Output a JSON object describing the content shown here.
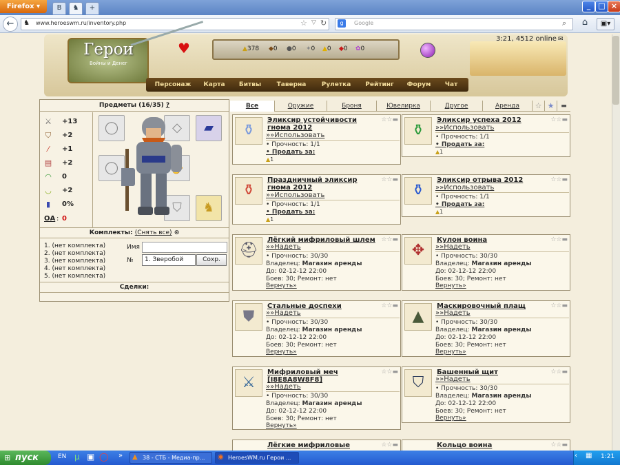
{
  "browser": {
    "firefox_label": "Firefox",
    "url": "www.heroeswm.ru/inventory.php",
    "search_placeholder": "Google",
    "tab1_icon": "В"
  },
  "header": {
    "logo_title": "Герои",
    "logo_sub": "Войны и Денег",
    "resources": [
      "378",
      "0",
      "0",
      "0",
      "0",
      "0",
      "0"
    ],
    "online": "3:21, 4512 online",
    "menu": [
      "Персонаж",
      "Карта",
      "Битвы",
      "Таверна",
      "Рулетка",
      "Рейтинг",
      "Форум",
      "Чат"
    ]
  },
  "left": {
    "items_title": "Предметы (16/35)",
    "help": "?",
    "stats": [
      "+13",
      "+2",
      "+1",
      "+2",
      "0",
      "+2",
      "0%"
    ],
    "oa_label": "ОА",
    "oa_value": "0",
    "kits_title": "Комплекты:",
    "kits_remove": "(Снять все)",
    "kits": [
      "1. (нет комплекта)",
      "2. (нет комплекта)",
      "3. (нет комплекта)",
      "4. (нет комплекта)",
      "5. (нет комплекта)"
    ],
    "name_label": "Имя",
    "no_label": "№",
    "kit_select": "1. Зверобой",
    "save": "Сохр.",
    "deals": "Сделки:"
  },
  "tabs": [
    "Все",
    "Оружие",
    "Броня",
    "Ювелирка",
    "Другое",
    "Аренда"
  ],
  "labels": {
    "use": "»»Использовать",
    "wear": "»»Надеть",
    "sell": "Продать за:",
    "return": "Вернуть»",
    "owner": "Владелец:",
    "shop": "Магазин аренды",
    "until": "До: 02-12-12 22:00",
    "fights": "Боев: 30;   Ремонт: нет"
  },
  "items": [
    {
      "name": "Эликсир устойчивости гнома 2012",
      "durability": "Прочность: 1/1",
      "count": "1"
    },
    {
      "name": "Эликсир успеха 2012",
      "durability": "Прочность: 1/1",
      "count": "1"
    },
    {
      "name": "Праздничный эликсир гнома 2012",
      "durability": "Прочность: 1/1",
      "count": "1"
    },
    {
      "name": "Эликсир отрыва 2012",
      "durability": "Прочность: 1/1",
      "count": "1"
    },
    {
      "name": "Лёгкий мифриловый шлем",
      "durability": "Прочность: 30/30"
    },
    {
      "name": "Кулон воина",
      "durability": "Прочность: 30/30"
    },
    {
      "name": "Стальные доспехи",
      "durability": "Прочность: 30/30"
    },
    {
      "name": "Маскировочный плащ",
      "durability": "Прочность: 30/30"
    },
    {
      "name": "Мифриловый меч [I8E8A8W8F8]",
      "durability": "Прочность: 30/30"
    },
    {
      "name": "Башенный щит",
      "durability": "Прочность: 30/30"
    },
    {
      "name": "Лёгкие мифриловые сапоги"
    },
    {
      "name": "Кольцо воина"
    }
  ],
  "taskbar": {
    "start": "пуск",
    "lang": "EN",
    "task1": "38 - СТБ - Медиа-пр...",
    "task2": "HeroesWM.ru Герои ...",
    "clock": "1:21"
  }
}
